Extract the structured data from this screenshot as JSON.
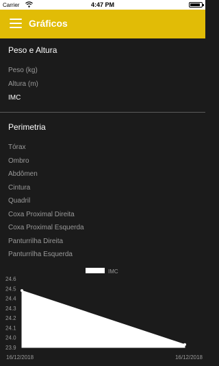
{
  "status_bar": {
    "carrier": "Carrier",
    "time": "4:47 PM",
    "battery_level": 0.9
  },
  "app_bar": {
    "title": "Gráficos",
    "menu_icon": "hamburger-menu-icon",
    "background": "#e1bc06"
  },
  "sections": [
    {
      "title": "Peso e Altura",
      "items": [
        "Peso (kg)",
        "Altura (m)",
        "IMC"
      ],
      "active_index": 2
    },
    {
      "title": "Perimetria",
      "items": [
        "Tórax",
        "Ombro",
        "Abdômen",
        "Cintura",
        "Quadril",
        "Coxa Proximal Direita",
        "Coxa Proximal Esquerda",
        "Panturrilha Direita",
        "Panturrilha Esquerda"
      ]
    }
  ],
  "chart_data": {
    "type": "area",
    "legend": "IMC",
    "legend_placement": "top-center",
    "x": [
      "16/12/2018",
      "16/12/2018"
    ],
    "series": [
      {
        "name": "IMC",
        "values": [
          24.48,
          23.93
        ]
      }
    ],
    "yticks": [
      23.9,
      24.0,
      24.1,
      24.2,
      24.3,
      24.4,
      24.5,
      24.6
    ],
    "ylim": [
      23.9,
      24.6
    ],
    "grid": false,
    "fill_color": "#ffffff"
  }
}
